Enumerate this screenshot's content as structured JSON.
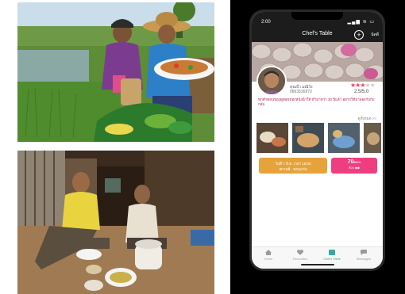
{
  "phone": {
    "status_time": "2:00",
    "status_right": "▂▄▆ ≋ ▭",
    "title": "Chef's Table",
    "add_icon": "plus-circle-icon",
    "add_label": "นัดดี",
    "chef": {
      "name": "คุณป้า มณีวัง",
      "phone": "0863536870",
      "rating_text": "2.5/5.0",
      "stars_filled": 2.5,
      "stars_total": 5
    },
    "description": "ทุกคำตอนของดูดอมของหนังนำให้ ทำมาหว่า 30 ปีแล้ว อยากให้มาลองกับกับกลับ",
    "see_all": "ดูทั้งหมด >>",
    "button_left": {
      "line1": "วันที่ 7 มี.ค. เวลา 18:00",
      "line2": "สถานที่ : ขอนแก่น"
    },
    "button_right": {
      "price": "70",
      "unit": "฿/คน",
      "sub": "904 ◆◆"
    },
    "tabs": [
      "Home",
      "Favourites",
      "Chef's Table",
      "Messages"
    ],
    "active_tab": 2,
    "accent": "#ee3e7f",
    "orange": "#e6a33a",
    "teal": "#3aa7a3"
  }
}
